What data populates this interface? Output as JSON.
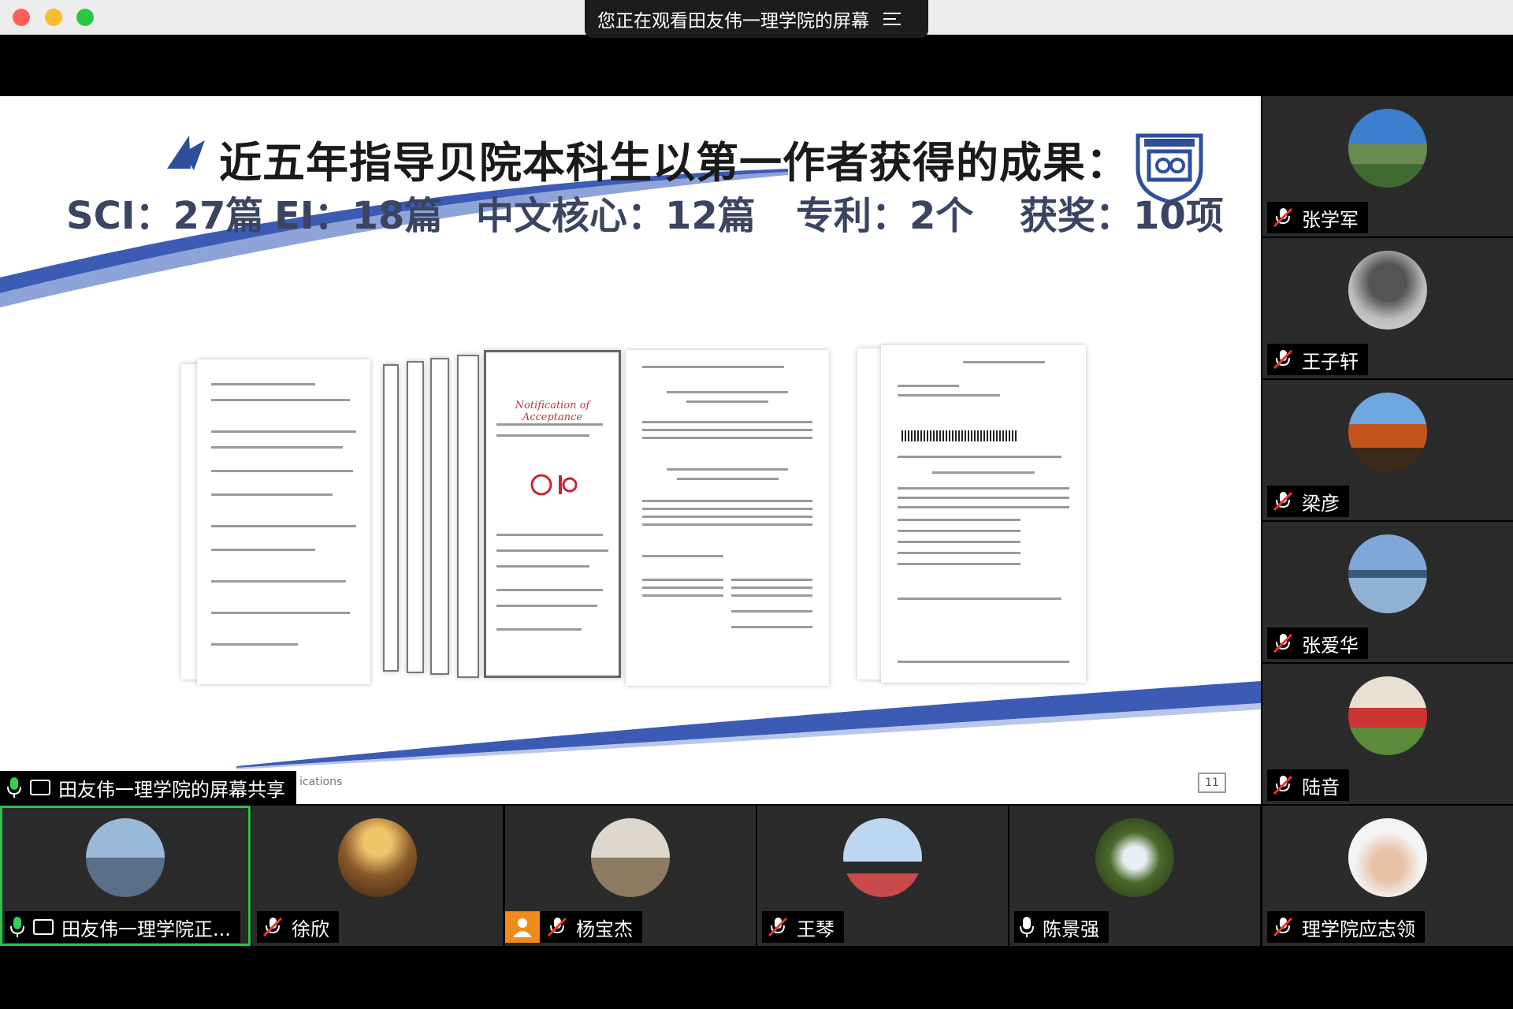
{
  "window": {
    "banner_text": "您正在观看田友伟一理学院的屏幕"
  },
  "slide": {
    "title": "近五年指导贝院本科生以第一作者获得的成果：",
    "stats": {
      "sci": "SCI：27篇",
      "ei": "EI：18篇",
      "core": "中文核心：12篇",
      "patent": "专利：2个",
      "award": "获奖：10项"
    },
    "notice_title": "Notification of Acceptance",
    "page_number": "11",
    "footer_partial": "ications"
  },
  "presenter_tag": "田友伟一理学院的屏幕共享",
  "sidebar": [
    {
      "name": "张学军"
    },
    {
      "name": "王子轩"
    },
    {
      "name": "梁彦"
    },
    {
      "name": "张爱华"
    },
    {
      "name": "陆音"
    }
  ],
  "bottom_row": [
    {
      "name": "田友伟一理学院正..."
    },
    {
      "name": "徐欣"
    },
    {
      "name": "杨宝杰"
    },
    {
      "name": "王琴"
    },
    {
      "name": "陈景强"
    },
    {
      "name": "理学院应志领"
    }
  ],
  "colors": {
    "active_border": "#27c24c",
    "accent_blue": "#3b5bb5",
    "muted_mic": "#e53935"
  }
}
